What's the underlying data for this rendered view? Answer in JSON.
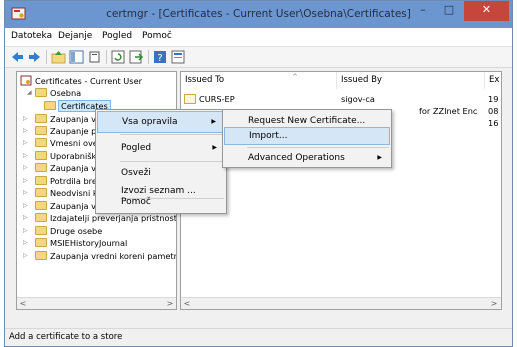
{
  "window": {
    "title": "certmgr - [Certificates - Current User\\Osebna\\Certificates]",
    "minimize": "–",
    "maximize": "□",
    "close": "✕"
  },
  "menubar": [
    "Datoteka",
    "Dejanje",
    "Pogled",
    "Pomoč"
  ],
  "toolbar_icons": [
    "back-icon",
    "forward-icon",
    "up-folder-icon",
    "show-hide-tree-icon",
    "copy-icon",
    "refresh-icon",
    "export-icon",
    "help-icon",
    "properties-icon"
  ],
  "tree": {
    "root": "Certificates - Current User",
    "items": [
      {
        "label": "Osebna",
        "expanded": true
      },
      {
        "label": "Certificates",
        "selected": true
      },
      {
        "label": "Zaupanja vredni koreni"
      },
      {
        "label": "Zaupanje podjetja"
      },
      {
        "label": "Vmesni overitelji"
      },
      {
        "label": "Uporabniški objekti"
      },
      {
        "label": "Zaupanja vredni izdajatelji"
      },
      {
        "label": "Potrdila brez zaupanja"
      },
      {
        "label": "Neodvisni korenski overitelji"
      },
      {
        "label": "Zaupanja vredne osebe"
      },
      {
        "label": "Izdajatelji preverjanja pristnosti"
      },
      {
        "label": "Druge osebe"
      },
      {
        "label": "MSIEHistoryJournal"
      },
      {
        "label": "Zaupanja vredni koreni pametnih kartic"
      }
    ]
  },
  "list": {
    "columns": [
      "Issued To",
      "Issued By",
      "Ex"
    ],
    "rows": [
      {
        "issued_to": "CURS-EP",
        "issued_by": "sigov-ca",
        "expires": "19"
      },
      {
        "issued_to": "",
        "issued_by": "for ZZInet Enc",
        "expires": "08"
      },
      {
        "issued_to": "",
        "issued_by": "",
        "expires": "16"
      }
    ]
  },
  "context_menu": {
    "items": [
      "Vsa opravila",
      "Pogled",
      "Osveži",
      "Izvozi seznam ...",
      "Pomoč"
    ]
  },
  "submenu": {
    "items": [
      "Request New Certificate...",
      "Import...",
      "Advanced Operations"
    ]
  },
  "status": "Add a certificate to a store",
  "colors": {
    "titlebar": "#6c96cf",
    "close": "#c7463c",
    "selection": "#cce8ff",
    "highlight": "#d5e6f7"
  }
}
